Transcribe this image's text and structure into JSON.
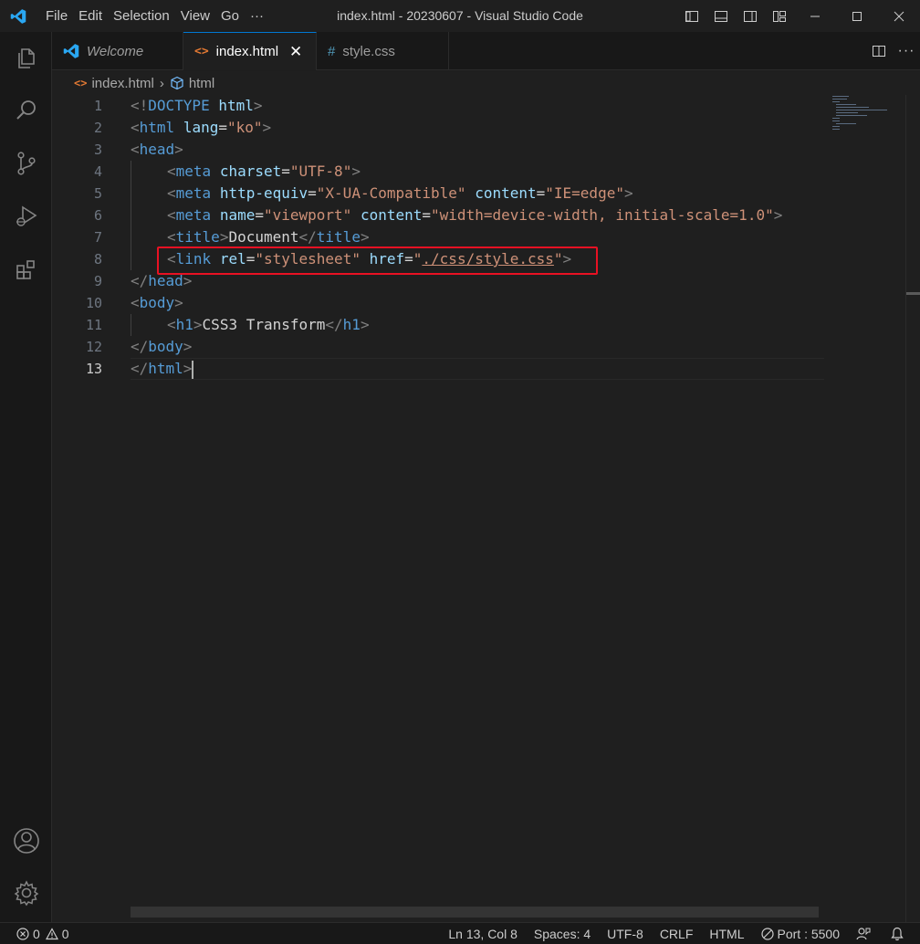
{
  "titlebar": {
    "menu": [
      "File",
      "Edit",
      "Selection",
      "View",
      "Go",
      "···"
    ],
    "title": "index.html - 20230607 - Visual Studio Code"
  },
  "tabs": [
    {
      "label": "Welcome",
      "icon": "vscode-icon",
      "active": false
    },
    {
      "label": "index.html",
      "icon": "html-icon",
      "active": true,
      "close": "✕"
    },
    {
      "label": "style.css",
      "icon": "css-hash-icon",
      "active": false,
      "hash": "#"
    }
  ],
  "breadcrumbs": {
    "file": "index.html",
    "symbol": "html"
  },
  "editor": {
    "line_numbers": [
      "1",
      "2",
      "3",
      "4",
      "5",
      "6",
      "7",
      "8",
      "9",
      "10",
      "11",
      "12",
      "13"
    ],
    "current_line": "13",
    "lines": {
      "l1": {
        "open": "<!",
        "doctype": "DOCTYPE",
        "html": "html",
        "close": ">"
      },
      "l2": {
        "lt": "<",
        "tag": "html",
        "attr": "lang",
        "eq": "=",
        "val": "\"ko\"",
        "gt": ">"
      },
      "l3": {
        "lt": "<",
        "tag": "head",
        "gt": ">"
      },
      "l4": {
        "lt": "<",
        "tag": "meta",
        "attr": "charset",
        "eq": "=",
        "val": "\"UTF-8\"",
        "gt": ">"
      },
      "l5": {
        "lt": "<",
        "tag": "meta",
        "attr1": "http-equiv",
        "eq1": "=",
        "val1": "\"X-UA-Compatible\"",
        "attr2": "content",
        "eq2": "=",
        "val2": "\"IE=edge\"",
        "gt": ">"
      },
      "l6": {
        "lt": "<",
        "tag": "meta",
        "attr1": "name",
        "eq1": "=",
        "val1": "\"viewport\"",
        "attr2": "content",
        "eq2": "=",
        "val2": "\"width=device-width, initial-scale=1.0\"",
        "gt": ">"
      },
      "l7": {
        "lt": "<",
        "tag": "title",
        "gt": ">",
        "text": "Document",
        "lt2": "</",
        "tag2": "title",
        "gt2": ">"
      },
      "l8": {
        "lt": "<",
        "tag": "link",
        "attr1": "rel",
        "eq1": "=",
        "val1": "\"stylesheet\"",
        "attr2": "href",
        "eq2": "=",
        "q1": "\"",
        "path": "./css/style.css",
        "q2": "\"",
        "gt": ">"
      },
      "l9": {
        "lt": "</",
        "tag": "head",
        "gt": ">"
      },
      "l10": {
        "lt": "<",
        "tag": "body",
        "gt": ">"
      },
      "l11": {
        "lt": "<",
        "tag": "h1",
        "gt": ">",
        "text": "CSS3 Transform",
        "lt2": "</",
        "tag2": "h1",
        "gt2": ">"
      },
      "l12": {
        "lt": "</",
        "tag": "body",
        "gt": ">"
      },
      "l13": {
        "lt": "</",
        "tag": "html",
        "gt": ">"
      }
    }
  },
  "statusbar": {
    "errors": "0",
    "warnings": "0",
    "position": "Ln 13, Col 8",
    "spaces": "Spaces: 4",
    "encoding": "UTF-8",
    "eol": "CRLF",
    "language": "HTML",
    "port": "Port : 5500"
  },
  "colors": {
    "accent": "#0078d4",
    "highlight_box": "#e81123",
    "tag": "#569cd6",
    "attribute": "#9cdcfe",
    "string": "#ce9178"
  }
}
